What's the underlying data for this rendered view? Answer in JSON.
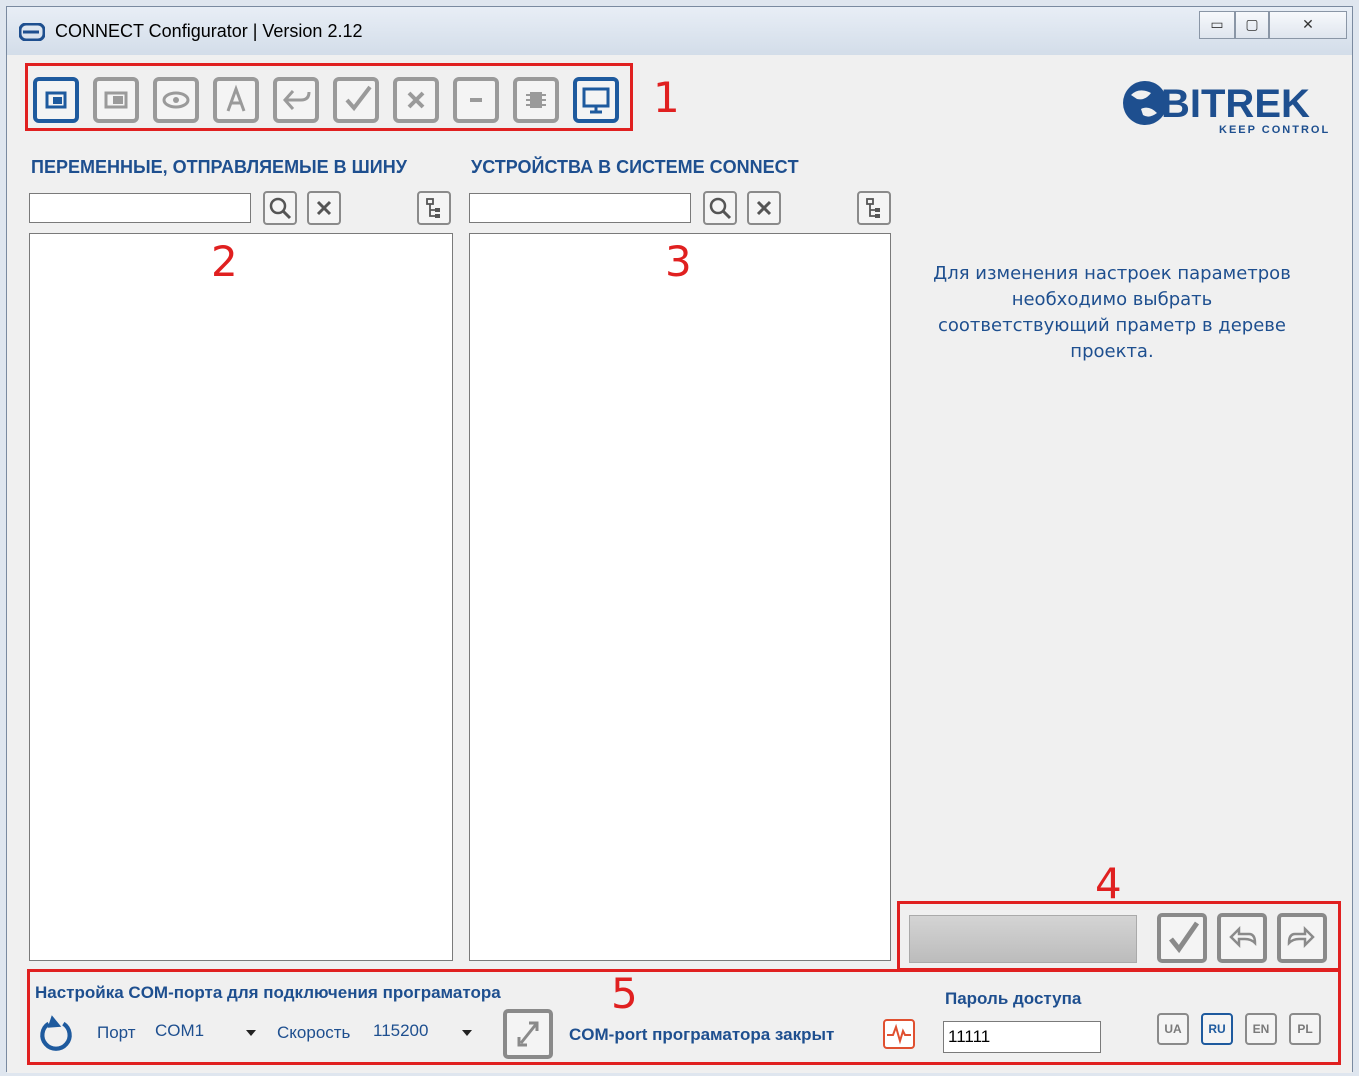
{
  "window": {
    "title": "CONNECT Configurator | Version 2.12",
    "controls": {
      "minimize": "▭",
      "maximize": "▢",
      "close": "✕"
    }
  },
  "annotations": [
    "1",
    "2",
    "3",
    "4",
    "5"
  ],
  "toolbar": {
    "buttons": [
      {
        "icon": "new-project-icon",
        "active": true
      },
      {
        "icon": "open-project-icon",
        "active": false
      },
      {
        "icon": "view-icon",
        "active": false
      },
      {
        "icon": "text-a-icon",
        "active": false
      },
      {
        "icon": "import-icon",
        "active": false
      },
      {
        "icon": "check-icon",
        "active": false
      },
      {
        "icon": "delete-icon",
        "active": false
      },
      {
        "icon": "minus-icon",
        "active": false
      },
      {
        "icon": "chip-icon",
        "active": false
      },
      {
        "icon": "monitor-icon",
        "active": true
      }
    ]
  },
  "logo": {
    "brand": "BITREK",
    "tagline": "KEEP CONTROL"
  },
  "left_panel": {
    "title": "ПЕРЕМЕННЫЕ, ОТПРАВЛЯЕМЫЕ В ШИНУ",
    "search_value": ""
  },
  "middle_panel": {
    "title": "УСТРОЙСТВА В СИСТЕМЕ CONNECT",
    "search_value": ""
  },
  "info_text": "Для изменения настроек параметров необходимо выбрать соответствующий праметр в дереве проекта.",
  "bottom": {
    "section_title": "Настройка COM-порта для подключения програматора",
    "port_label": "Порт",
    "port_value": "COM1",
    "speed_label": "Скорость",
    "speed_value": "115200",
    "status_text": "COM-port програматора закрыт",
    "password_label": "Пароль доступа",
    "password_value": "11111",
    "languages": [
      {
        "code": "UA",
        "active": false
      },
      {
        "code": "RU",
        "active": true
      },
      {
        "code": "EN",
        "active": false
      },
      {
        "code": "PL",
        "active": false
      }
    ]
  },
  "colors": {
    "accent": "#1e4f8f",
    "annotation": "#e02020",
    "inactive": "#8a8a8a"
  }
}
